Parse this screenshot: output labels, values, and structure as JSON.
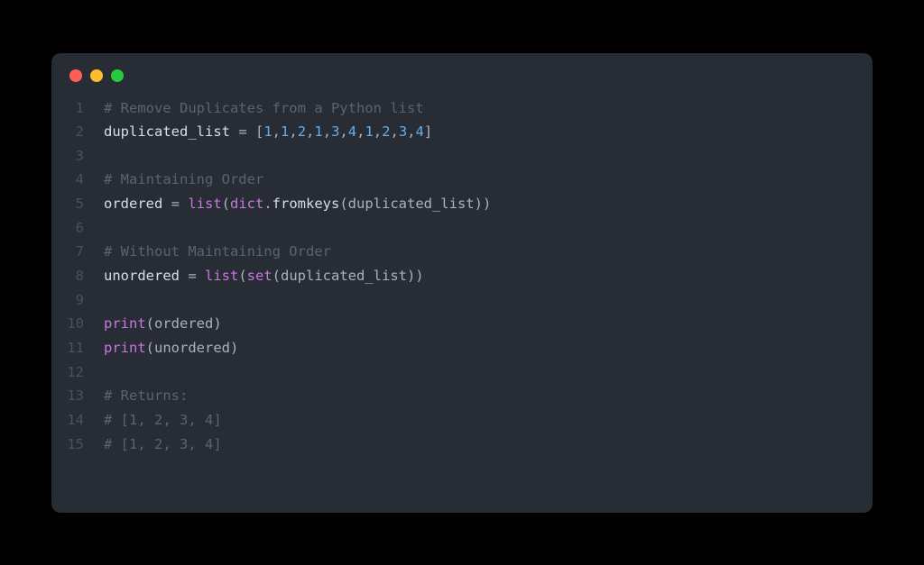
{
  "lines": [
    {
      "num": "1",
      "tokens": [
        {
          "t": "# Remove Duplicates from a Python list",
          "c": "comment"
        }
      ]
    },
    {
      "num": "2",
      "tokens": [
        {
          "t": "duplicated_list",
          "c": "ident"
        },
        {
          "t": " = [",
          "c": "punct"
        },
        {
          "t": "1",
          "c": "number"
        },
        {
          "t": ",",
          "c": "punct"
        },
        {
          "t": "1",
          "c": "number"
        },
        {
          "t": ",",
          "c": "punct"
        },
        {
          "t": "2",
          "c": "number"
        },
        {
          "t": ",",
          "c": "punct"
        },
        {
          "t": "1",
          "c": "number"
        },
        {
          "t": ",",
          "c": "punct"
        },
        {
          "t": "3",
          "c": "number"
        },
        {
          "t": ",",
          "c": "punct"
        },
        {
          "t": "4",
          "c": "number"
        },
        {
          "t": ",",
          "c": "punct"
        },
        {
          "t": "1",
          "c": "number"
        },
        {
          "t": ",",
          "c": "punct"
        },
        {
          "t": "2",
          "c": "number"
        },
        {
          "t": ",",
          "c": "punct"
        },
        {
          "t": "3",
          "c": "number"
        },
        {
          "t": ",",
          "c": "punct"
        },
        {
          "t": "4",
          "c": "number"
        },
        {
          "t": "]",
          "c": "punct"
        }
      ]
    },
    {
      "num": "3",
      "tokens": []
    },
    {
      "num": "4",
      "tokens": [
        {
          "t": "# Maintaining Order",
          "c": "comment"
        }
      ]
    },
    {
      "num": "5",
      "tokens": [
        {
          "t": "ordered",
          "c": "ident"
        },
        {
          "t": " = ",
          "c": "punct"
        },
        {
          "t": "list",
          "c": "builtin"
        },
        {
          "t": "(",
          "c": "punct"
        },
        {
          "t": "dict",
          "c": "builtin"
        },
        {
          "t": ".",
          "c": "punct"
        },
        {
          "t": "fromkeys",
          "c": "ident"
        },
        {
          "t": "(duplicated_list))",
          "c": "punct"
        }
      ]
    },
    {
      "num": "6",
      "tokens": []
    },
    {
      "num": "7",
      "tokens": [
        {
          "t": "# Without Maintaining Order",
          "c": "comment"
        }
      ]
    },
    {
      "num": "8",
      "tokens": [
        {
          "t": "unordered",
          "c": "ident"
        },
        {
          "t": " = ",
          "c": "punct"
        },
        {
          "t": "list",
          "c": "builtin"
        },
        {
          "t": "(",
          "c": "punct"
        },
        {
          "t": "set",
          "c": "builtin"
        },
        {
          "t": "(duplicated_list))",
          "c": "punct"
        }
      ]
    },
    {
      "num": "9",
      "tokens": []
    },
    {
      "num": "10",
      "tokens": [
        {
          "t": "print",
          "c": "builtin"
        },
        {
          "t": "(ordered)",
          "c": "punct"
        }
      ]
    },
    {
      "num": "11",
      "tokens": [
        {
          "t": "print",
          "c": "builtin"
        },
        {
          "t": "(unordered)",
          "c": "punct"
        }
      ]
    },
    {
      "num": "12",
      "tokens": []
    },
    {
      "num": "13",
      "tokens": [
        {
          "t": "# Returns:",
          "c": "comment"
        }
      ]
    },
    {
      "num": "14",
      "tokens": [
        {
          "t": "# [1, 2, 3, 4]",
          "c": "comment"
        }
      ]
    },
    {
      "num": "15",
      "tokens": [
        {
          "t": "# [1, 2, 3, 4]",
          "c": "comment"
        }
      ]
    }
  ]
}
